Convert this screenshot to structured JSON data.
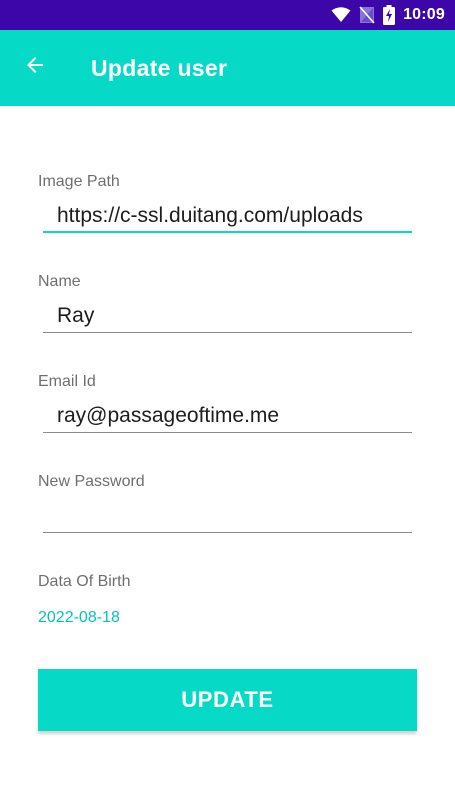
{
  "status_bar": {
    "time": "10:09",
    "icons": [
      "wifi-icon",
      "no-sim-icon",
      "battery-charging-icon"
    ],
    "background_color": "#3d06a8"
  },
  "app_bar": {
    "title": "Update user",
    "back_icon": "arrow-left-icon",
    "background_color": "#06dac6"
  },
  "form": {
    "image_path": {
      "label": "Image Path",
      "value": "https://c-ssl.duitang.com/uploads"
    },
    "name": {
      "label": "Name",
      "value": "Ray"
    },
    "email": {
      "label": "Email Id",
      "value": "ray@passageoftime.me"
    },
    "new_password": {
      "label": "New Password",
      "value": ""
    },
    "date_of_birth": {
      "label": "Data Of Birth",
      "value": "2022-08-18"
    },
    "update_button_label": "UPDATE"
  },
  "colors": {
    "accent": "#06dac6",
    "accent_text": "#06c3b3",
    "label_gray": "#6f6f6f"
  }
}
